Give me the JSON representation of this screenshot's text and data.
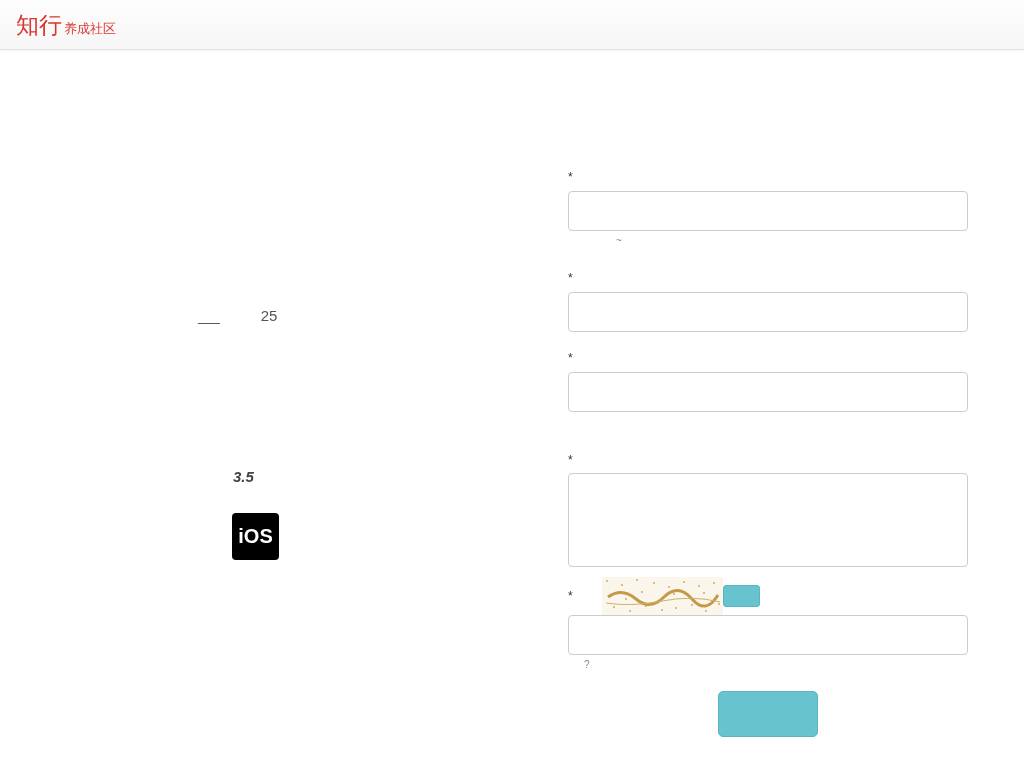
{
  "header": {
    "logo": {
      "main": "知行",
      "sub": "养成社区"
    }
  },
  "left_panel": {
    "line": "___",
    "count": "25",
    "rating": "3.5",
    "platform_badge": "iOS"
  },
  "form": {
    "fields": [
      {
        "kind": "input",
        "label": "*",
        "hint": "~"
      },
      {
        "kind": "input",
        "label": "*"
      },
      {
        "kind": "input",
        "label": "*"
      },
      {
        "kind": "textarea",
        "label": "*"
      },
      {
        "kind": "captcha",
        "label": "*",
        "hint": "?"
      }
    ]
  }
}
